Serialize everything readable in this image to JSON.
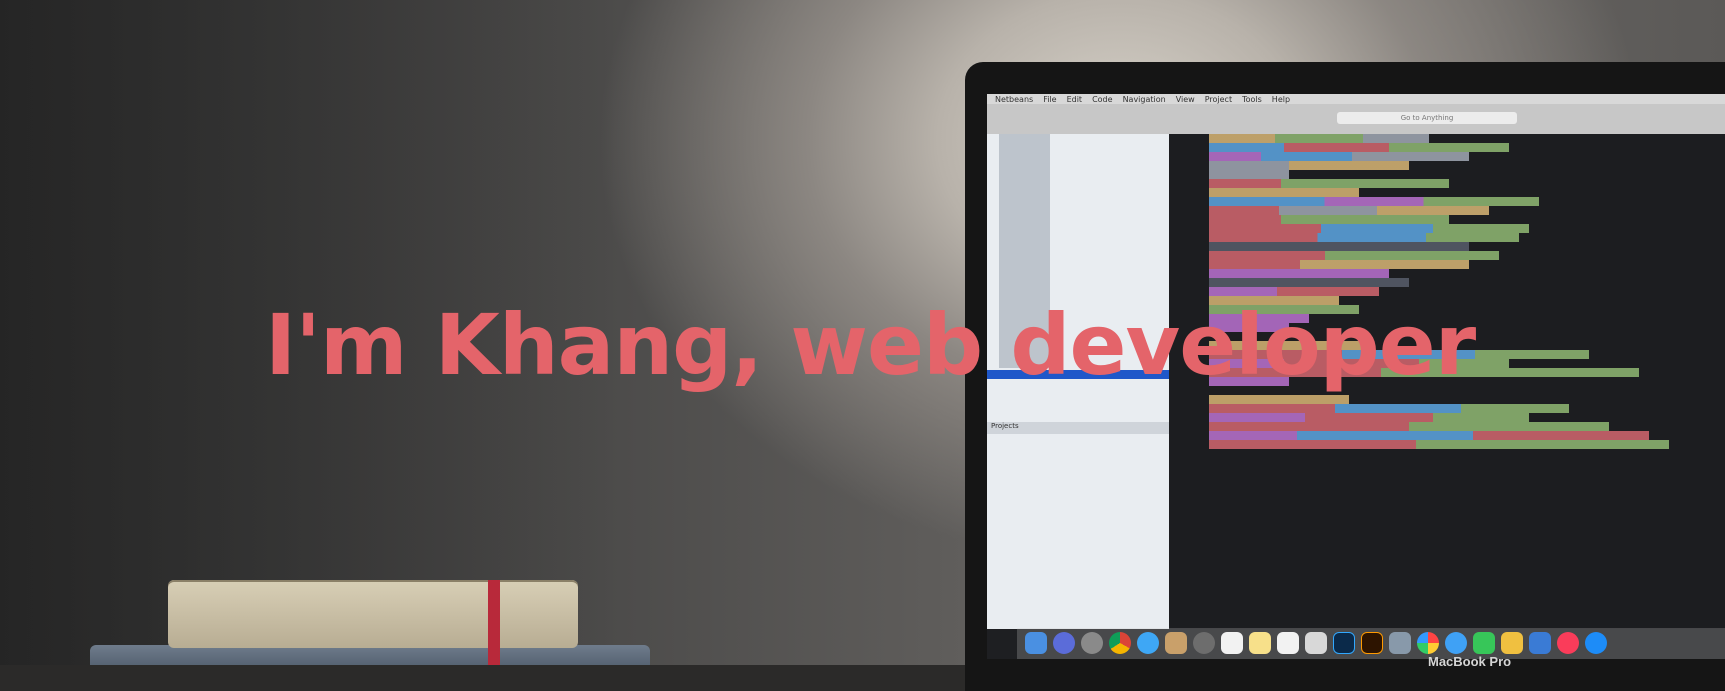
{
  "hero": {
    "headline": "I'm Khang, web developer",
    "accent_color": "#e4646a"
  },
  "laptop": {
    "brand": "MacBook Pro",
    "screen": {
      "menu_items": [
        "Netbeans",
        "File",
        "Edit",
        "Code",
        "Navigation",
        "View",
        "Project",
        "Tools",
        "Help"
      ],
      "search_label": "Go to Anything",
      "projects_label": "Projects"
    }
  }
}
